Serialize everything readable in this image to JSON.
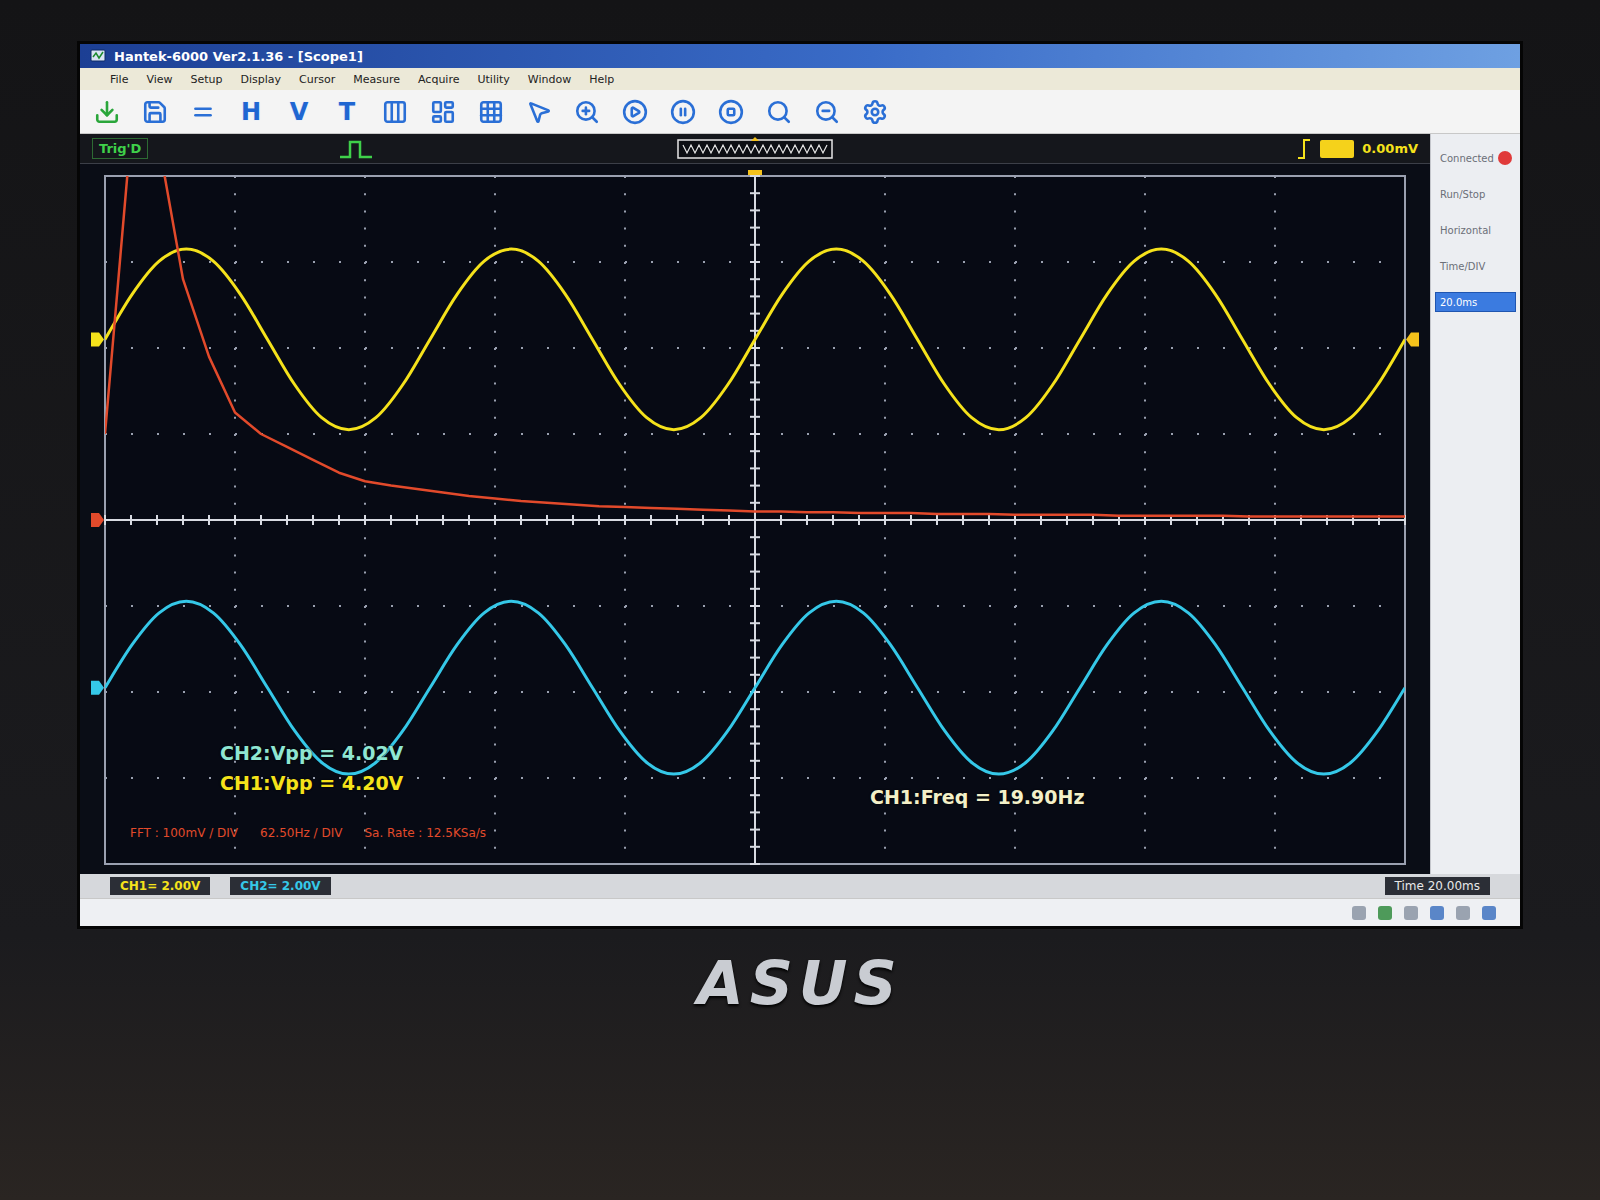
{
  "window": {
    "title": "Hantek-6000 Ver2.1.36 - [Scope1]"
  },
  "menu": [
    "File",
    "View",
    "Setup",
    "Display",
    "Cursor",
    "Measure",
    "Acquire",
    "Utility",
    "Window",
    "Help"
  ],
  "toolbar": [
    {
      "kind": "icon"
    },
    {
      "kind": "icon"
    },
    {
      "kind": "icon"
    },
    {
      "kind": "glyph",
      "label": "H"
    },
    {
      "kind": "glyph",
      "label": "V"
    },
    {
      "kind": "glyph",
      "label": "T"
    },
    {
      "kind": "icon"
    },
    {
      "kind": "icon"
    },
    {
      "kind": "icon"
    },
    {
      "kind": "icon"
    },
    {
      "kind": "icon"
    },
    {
      "kind": "icon"
    },
    {
      "kind": "icon"
    },
    {
      "kind": "icon"
    },
    {
      "kind": "icon"
    },
    {
      "kind": "icon"
    },
    {
      "kind": "icon"
    }
  ],
  "trigger": {
    "status": "Trig'D",
    "level": "0.00mV"
  },
  "scope": {
    "divisions": {
      "x": 10,
      "y": 8
    },
    "series": [
      {
        "name": "CH1",
        "kind": "wave",
        "color": "#f5e21b",
        "per_div": 2,
        "offset_div": 2.1,
        "values": [
          0,
          1.05,
          1.82,
          2.1,
          1.82,
          1.05,
          0,
          -1.05,
          -1.82,
          -2.1,
          -1.82,
          -1.05,
          0,
          1.05,
          1.82,
          2.1,
          1.82,
          1.05,
          0,
          -1.05,
          -1.82,
          -2.1,
          -1.82,
          -1.05,
          0,
          1.05,
          1.82,
          2.1,
          1.82,
          1.05,
          0,
          -1.05,
          -1.82,
          -2.1,
          -1.82,
          -1.05,
          0,
          1.05,
          1.82,
          2.1,
          1.82,
          1.05,
          0,
          -1.05,
          -1.82,
          -2.1,
          -1.82,
          -1.05,
          0
        ]
      },
      {
        "name": "CH2",
        "kind": "wave",
        "color": "#35c8e8",
        "per_div": 2,
        "offset_div": -1.95,
        "values": [
          0,
          1.0,
          1.74,
          2.01,
          1.74,
          1.0,
          0,
          -1.0,
          -1.74,
          -2.01,
          -1.74,
          -1.0,
          0,
          1.0,
          1.74,
          2.01,
          1.74,
          1.0,
          0,
          -1.0,
          -1.74,
          -2.01,
          -1.74,
          -1.0,
          0,
          1.0,
          1.74,
          2.01,
          1.74,
          1.0,
          0,
          -1.0,
          -1.74,
          -2.01,
          -1.74,
          -1.0,
          0,
          1.0,
          1.74,
          2.01,
          1.74,
          1.0,
          0,
          -1.0,
          -1.74,
          -2.01,
          -1.74,
          -1.0,
          0
        ]
      },
      {
        "name": "FFT",
        "kind": "spectrum",
        "color": "#e24a2b",
        "per_div": 100,
        "offset_div": 0,
        "values": [
          100,
          450,
          450,
          280,
          190,
          125,
          100,
          85,
          70,
          55,
          45,
          40,
          36,
          32,
          28,
          25,
          22,
          20,
          18,
          16,
          15,
          14,
          13,
          12,
          11,
          10,
          10,
          9,
          9,
          8,
          8,
          8,
          7,
          7,
          7,
          6,
          6,
          6,
          6,
          5,
          5,
          5,
          5,
          5,
          4,
          4,
          4,
          4,
          4,
          4,
          4
        ]
      }
    ],
    "measurements": [
      {
        "text": "CH2:Vpp = 4.02V",
        "color": "#8fe6d2"
      },
      {
        "text": "CH1:Vpp = 4.20V",
        "color": "#f5e21b"
      },
      {
        "text": "CH1:Freq = 19.90Hz",
        "color": "#f3f0c8"
      }
    ],
    "fft_info": [
      "FFT : 100mV / DIV",
      "62.50Hz / DIV",
      "Sa. Rate : 12.5KSa/s"
    ]
  },
  "side_panel": {
    "items": [
      {
        "label": "Connected",
        "kind": "status",
        "color": "#e03a3a",
        "selected": false
      },
      {
        "label": "Run/Stop",
        "kind": "label",
        "selected": false
      },
      {
        "label": "Horizontal",
        "kind": "label",
        "selected": false
      },
      {
        "label": "Time/DIV",
        "kind": "label",
        "selected": false
      },
      {
        "label": "20.0ms",
        "kind": "field",
        "selected": true
      }
    ]
  },
  "status_bar": {
    "channels": [
      {
        "text": "CH1= 2.00V",
        "color": "#f5e21b"
      },
      {
        "text": "CH2= 2.00V",
        "color": "#35c8e8"
      }
    ],
    "time": "Time 20.00ms"
  },
  "bezel": {
    "logo": "ASUS"
  }
}
